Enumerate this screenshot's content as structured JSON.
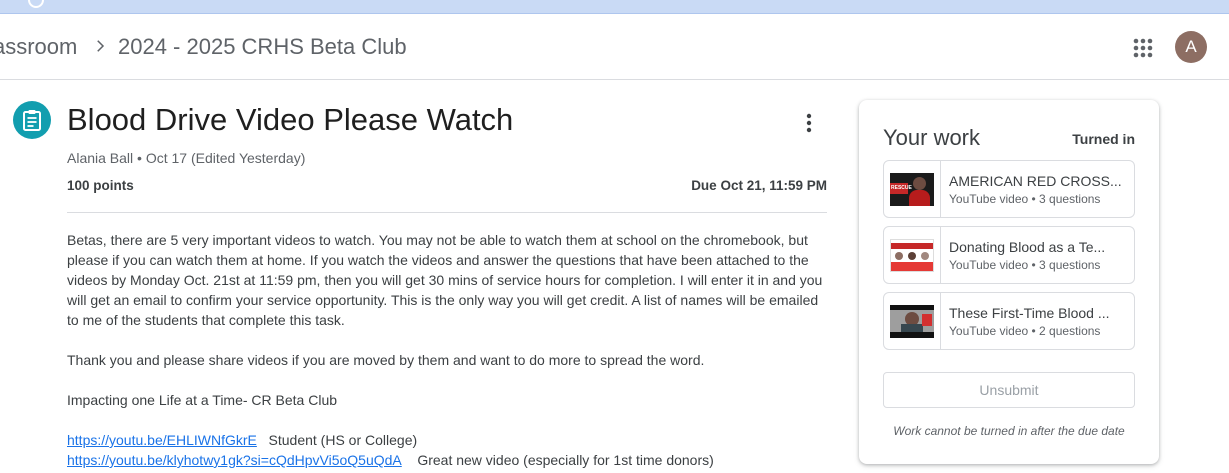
{
  "header": {
    "breadcrumb_first": "assroom",
    "breadcrumb_second": "2024 - 2025 CRHS Beta Club",
    "avatar_letter": "A"
  },
  "assignment": {
    "title": "Blood Drive Video Please Watch",
    "meta": "Alania Ball • Oct 17 (Edited Yesterday)",
    "points": "100 points",
    "due": "Due Oct 21, 11:59 PM",
    "paragraphs": [
      "Betas, there are 5 very important videos to watch. You may not be able to watch them at school on the chromebook, but please if you can watch them at home. If you watch the videos and answer the questions that have been attached to the videos by Monday Oct. 21st at 11:59 pm, then you will get 30 mins of service hours for completion. I will enter it in and you will get an email to confirm your service opportunity. This is the only way you will get credit. A list of names will be emailed to me of the students that complete this task.",
      "Thank you and please share videos if you are moved by them and want to do more to spread the word.",
      "Impacting one Life at a Time- CR Beta Club"
    ],
    "links": [
      {
        "url": "https://youtu.be/EHLIWNfGkrE",
        "note": "Student (HS or College)"
      },
      {
        "url": "https://youtu.be/klyhotwy1gk?si=cQdHpvVi5oQ5uQdA",
        "note": "Great new video (especially for 1st time donors)"
      }
    ]
  },
  "your_work": {
    "title": "Your work",
    "status": "Turned in",
    "attachments": [
      {
        "title": "AMERICAN RED CROSS...",
        "subtitle": "YouTube video • 3 questions",
        "thumb_text": "RESCUE"
      },
      {
        "title": "Donating Blood as a Te...",
        "subtitle": "YouTube video • 3 questions"
      },
      {
        "title": "These First-Time Blood ...",
        "subtitle": "YouTube video • 2 questions"
      }
    ],
    "unsubmit_label": "Unsubmit",
    "note": "Work cannot be turned in after the due date"
  },
  "colors": {
    "accent_teal": "#129eaf",
    "link_blue": "#1a73e8",
    "avatar_brown": "#8d6e63"
  }
}
